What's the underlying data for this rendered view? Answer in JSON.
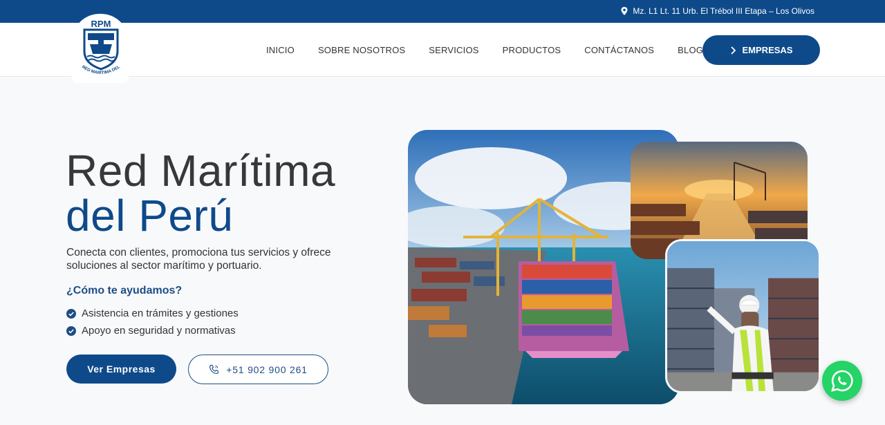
{
  "topbar": {
    "address": "Mz. L1 Lt. 11 Urb. El Trébol III Etapa – Los Olivos"
  },
  "logo": {
    "abbr": "RPM",
    "text": "RED MARÍTIMA DEL PERÚ"
  },
  "nav": {
    "items": [
      "INICIO",
      "SOBRE NOSOTROS",
      "SERVICIOS",
      "PRODUCTOS",
      "CONTÁCTANOS",
      "BLOG"
    ],
    "cta": "EMPRESAS"
  },
  "hero": {
    "title_line1": "Red Marítima",
    "title_line2": "del Perú",
    "description": "Conecta con clientes, promociona tus servicios y ofrece soluciones al sector marítimo y portuario.",
    "help_title": "¿Cómo te ayudamos?",
    "bullets": [
      "Asistencia en trámites y gestiones",
      "Apoyo en seguridad y normativas"
    ],
    "btn_primary": "Ver Empresas",
    "btn_phone": "+51 902 900 261"
  },
  "colors": {
    "brand": "#0e4a8a",
    "whatsapp": "#25d366"
  },
  "icons": [
    "location-pin-icon",
    "chevron-right-icon",
    "check-circle-icon",
    "phone-icon",
    "whatsapp-icon"
  ]
}
